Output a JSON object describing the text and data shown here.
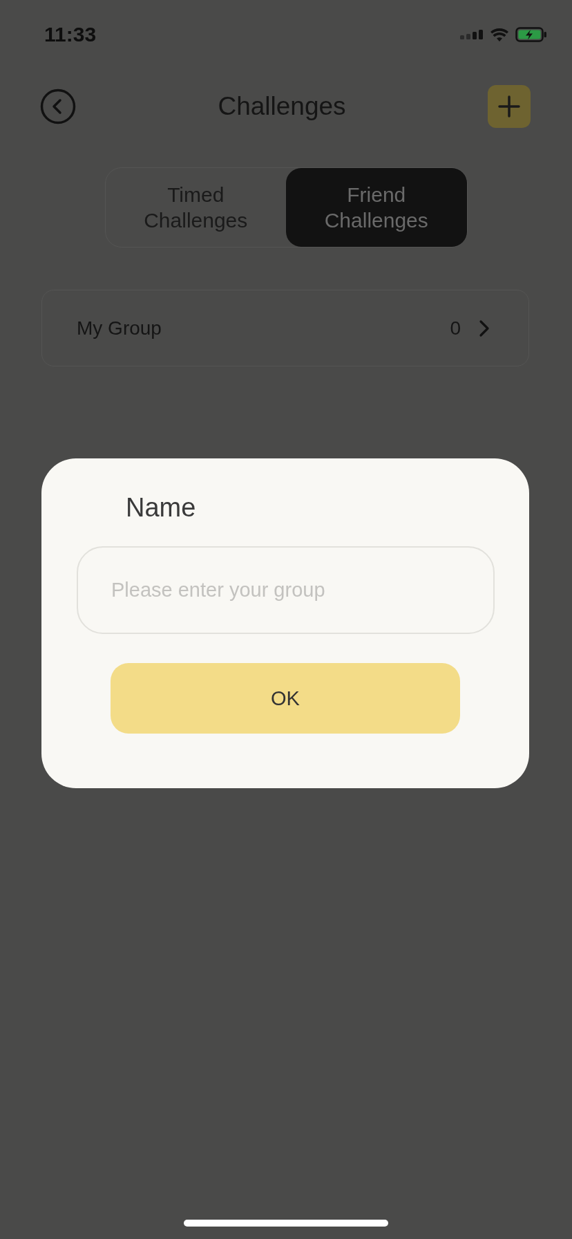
{
  "status_bar": {
    "time": "11:33"
  },
  "header": {
    "title": "Challenges"
  },
  "tabs": [
    {
      "label": "Timed Challenges",
      "selected": false
    },
    {
      "label": "Friend Challenges",
      "selected": true
    }
  ],
  "group_row": {
    "label": "My Group",
    "count": "0"
  },
  "dialog": {
    "title": "Name",
    "placeholder": "Please enter your group",
    "button": "OK"
  }
}
